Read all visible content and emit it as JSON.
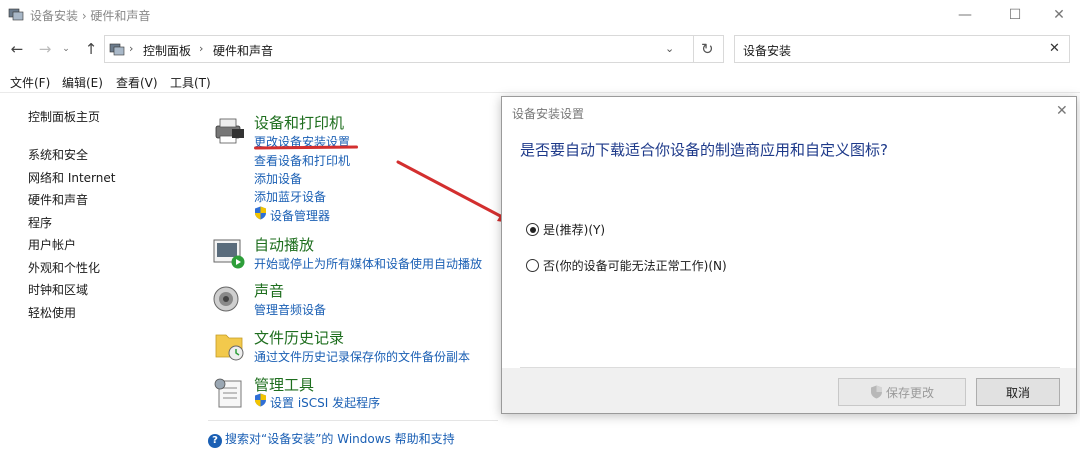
{
  "window": {
    "title": "设备安装 › 硬件和声音",
    "minimize_glyph": "—",
    "maximize_glyph": "☐",
    "close_glyph": "✕"
  },
  "address": {
    "crumbs": [
      "控制面板",
      "硬件和声音"
    ],
    "separator": "›",
    "search_value": "设备安装",
    "clear_glyph": "✕",
    "dropdown_glyph": "⌄",
    "refresh_glyph": "↻"
  },
  "nav": {
    "back_glyph": "←",
    "forward_glyph": "→",
    "recent_glyph": "⌄",
    "up_glyph": "↑"
  },
  "menu": [
    "文件(F)",
    "编辑(E)",
    "查看(V)",
    "工具(T)"
  ],
  "leftnav": {
    "home": "控制面板主页",
    "items": [
      "系统和安全",
      "网络和 Internet",
      "硬件和声音",
      "程序",
      "用户帐户",
      "外观和个性化",
      "时钟和区域",
      "轻松使用"
    ]
  },
  "categories": {
    "devices": {
      "heading": "设备和打印机",
      "links": [
        "更改设备安装设置",
        "查看设备和打印机",
        "添加设备",
        "添加蓝牙设备",
        "设备管理器"
      ]
    },
    "autoplay": {
      "heading": "自动播放",
      "links": [
        "开始或停止为所有媒体和设备使用自动播放"
      ]
    },
    "sound": {
      "heading": "声音",
      "links": [
        "管理音频设备"
      ]
    },
    "filehistory": {
      "heading": "文件历史记录",
      "links": [
        "通过文件历史记录保存你的文件备份副本"
      ]
    },
    "admintools": {
      "heading": "管理工具",
      "links": [
        "设置 iSCSI 发起程序"
      ]
    }
  },
  "help": {
    "icon": "?",
    "text": "搜索对“设备安装”的 Windows 帮助和支持"
  },
  "dialog": {
    "title": "设备安装设置",
    "close_glyph": "✕",
    "question": "是否要自动下载适合你设备的制造商应用和自定义图标?",
    "options": [
      {
        "label": "是(推荐)(Y)",
        "selected": true
      },
      {
        "label": "否(你的设备可能无法正常工作)(N)",
        "selected": false
      }
    ],
    "save_button": "保存更改",
    "cancel_button": "取消"
  },
  "colors": {
    "accent_link": "#1a5fb4",
    "heading_green": "#1e6e1e",
    "annotation_red": "#d32f2f"
  }
}
